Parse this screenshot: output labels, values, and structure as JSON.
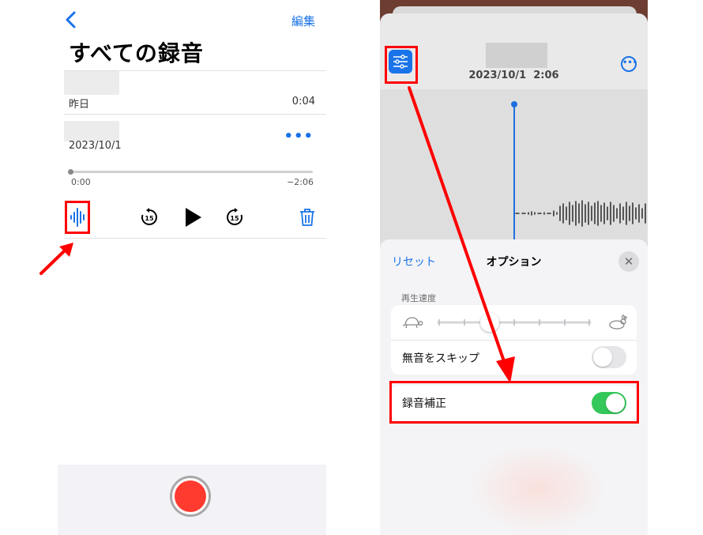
{
  "left": {
    "edit_label": "編集",
    "title": "すべての録音",
    "recordings": [
      {
        "date": "昨日",
        "duration": "0:04"
      },
      {
        "date": "2023/10/1",
        "more": "•••"
      }
    ],
    "player": {
      "elapsed": "0:00",
      "remaining": "−2:06",
      "skip_back": "15",
      "skip_fwd": "15",
      "progress": 0
    }
  },
  "right": {
    "date": "2023/10/1",
    "time": "2:06",
    "more": "•••",
    "options": {
      "reset_label": "リセット",
      "title": "オプション",
      "close_label": "✕",
      "speed_label": "再生速度",
      "skip_silence_label": "無音をスキップ",
      "skip_silence_on": false,
      "enhance_label": "録音補正",
      "enhance_on": true
    }
  },
  "colors": {
    "accent": "#1a73e8",
    "record": "#ff3b30",
    "toggle_on": "#34c759",
    "annotation": "#ff0000"
  },
  "icons": [
    "chevron-left-icon",
    "waveform-icon",
    "skip-back-15-icon",
    "play-icon",
    "skip-forward-15-icon",
    "trash-icon",
    "sliders-icon",
    "ellipsis-circle-icon",
    "turtle-icon",
    "rabbit-icon",
    "close-icon",
    "record-icon",
    "red-arrow-icon"
  ]
}
